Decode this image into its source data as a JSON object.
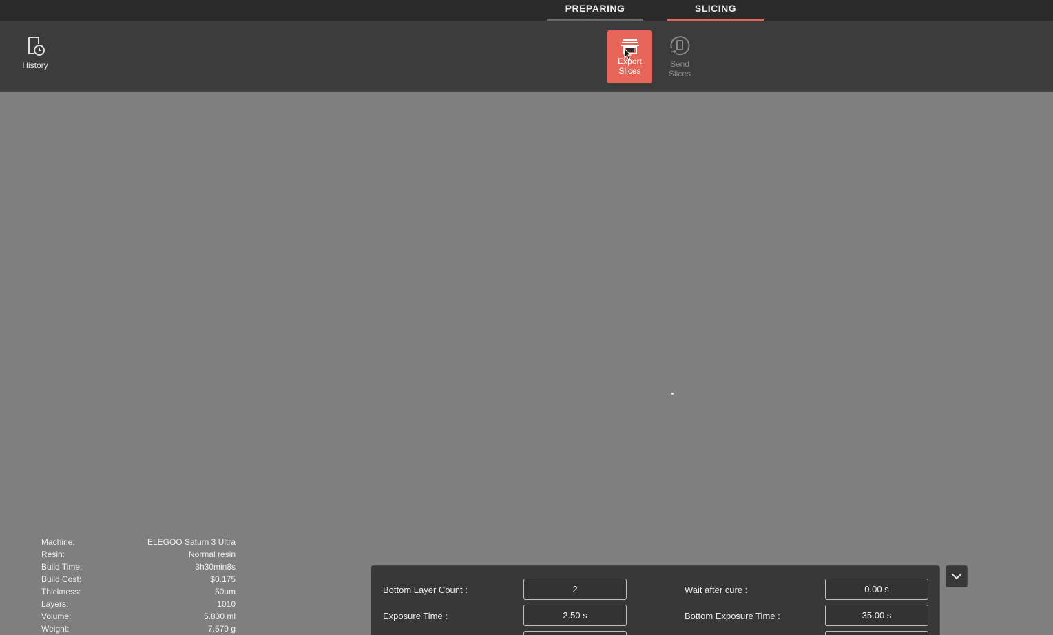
{
  "tabs": {
    "preparing": "PREPARING",
    "slicing": "SLICING"
  },
  "toolbar": {
    "history_label": "History",
    "export_label_line1": "Export",
    "export_label_line2": "Slices",
    "send_label_line1": "Send",
    "send_label_line2": "Slices"
  },
  "colors": {
    "accent": "#e8655a",
    "toolbar_bg": "#3c3c3c",
    "viewport_bg": "#7f7f7f"
  },
  "info": {
    "machine_label": "Machine:",
    "machine_value": "ELEGOO Saturn 3 Ultra",
    "resin_label": "Resin:",
    "resin_value": "Normal resin",
    "build_time_label": "Build Time:",
    "build_time_value": "3h30min8s",
    "build_cost_label": "Build Cost:",
    "build_cost_value": "$0.175",
    "thickness_label": "Thickness:",
    "thickness_value": "50um",
    "layers_label": "Layers:",
    "layers_value": "1010",
    "volume_label": "Volume:",
    "volume_value": "5.830 ml",
    "weight_label": "Weight:",
    "weight_value": "7.579 g"
  },
  "params": {
    "bottom_layer_count_label": "Bottom Layer Count :",
    "bottom_layer_count_value": "2",
    "wait_after_cure_label": "Wait after cure :",
    "wait_after_cure_value": "0.00 s",
    "exposure_time_label": "Exposure Time :",
    "exposure_time_value": "2.50 s",
    "bottom_exposure_time_label": "Bottom Exposure Time :",
    "bottom_exposure_time_value": "35.00 s"
  },
  "icons": {
    "history": "history-icon",
    "export": "export-slices-icon",
    "send": "send-slices-icon",
    "collapse": "chevron-down-icon"
  }
}
